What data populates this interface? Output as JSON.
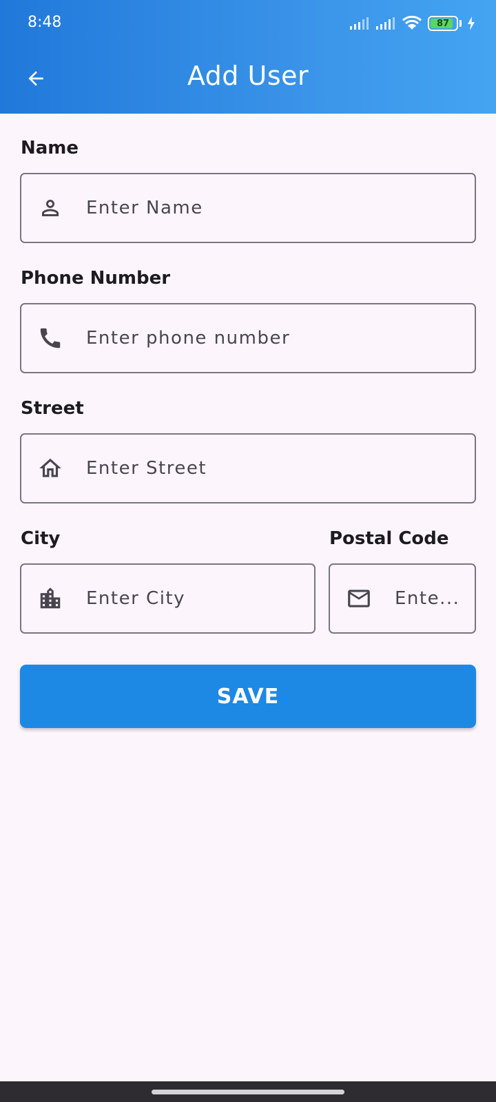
{
  "status_bar": {
    "time": "8:48",
    "battery_level": "87",
    "icons": [
      "cellular-signal-icon",
      "cellular-signal-icon",
      "wifi-icon",
      "battery-icon",
      "charging-bolt-icon"
    ]
  },
  "app_bar": {
    "title": "Add User",
    "back_icon": "arrow-back-icon",
    "gradient": [
      "#2079da",
      "#44a4f2"
    ]
  },
  "form": {
    "name": {
      "label": "Name",
      "placeholder": "Enter Name",
      "value": "",
      "icon": "person-icon"
    },
    "phone": {
      "label": "Phone Number",
      "placeholder": "Enter phone number",
      "value": "",
      "icon": "phone-icon"
    },
    "street": {
      "label": "Street",
      "placeholder": "Enter Street",
      "value": "",
      "icon": "home-icon"
    },
    "city": {
      "label": "City",
      "placeholder": "Enter City",
      "value": "",
      "icon": "city-icon"
    },
    "postal": {
      "label": "Postal Code",
      "placeholder": "Ente...",
      "value": "",
      "icon": "mail-icon"
    }
  },
  "save_button": {
    "label": "SAVE",
    "color": "#1e88e5"
  },
  "colors": {
    "background": "#fcf6fc",
    "field_border": "#79747e",
    "label_text": "#1d1b20",
    "placeholder_text": "#49454f"
  }
}
